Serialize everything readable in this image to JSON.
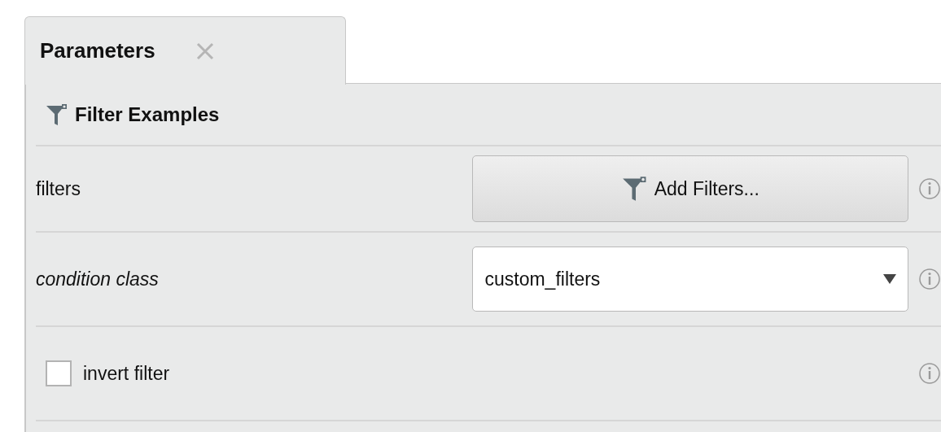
{
  "tabs": [
    {
      "label": "Parameters",
      "selected": true
    }
  ],
  "operator": {
    "name": "Filter Examples"
  },
  "parameters": [
    {
      "kind": "button",
      "label": "filters",
      "italic": false,
      "button_label": "Add Filters..."
    },
    {
      "kind": "dropdown",
      "label": "condition class",
      "italic": true,
      "value": "custom_filters"
    },
    {
      "kind": "checkbox",
      "label": "invert filter",
      "italic": false,
      "checked": false
    }
  ]
}
